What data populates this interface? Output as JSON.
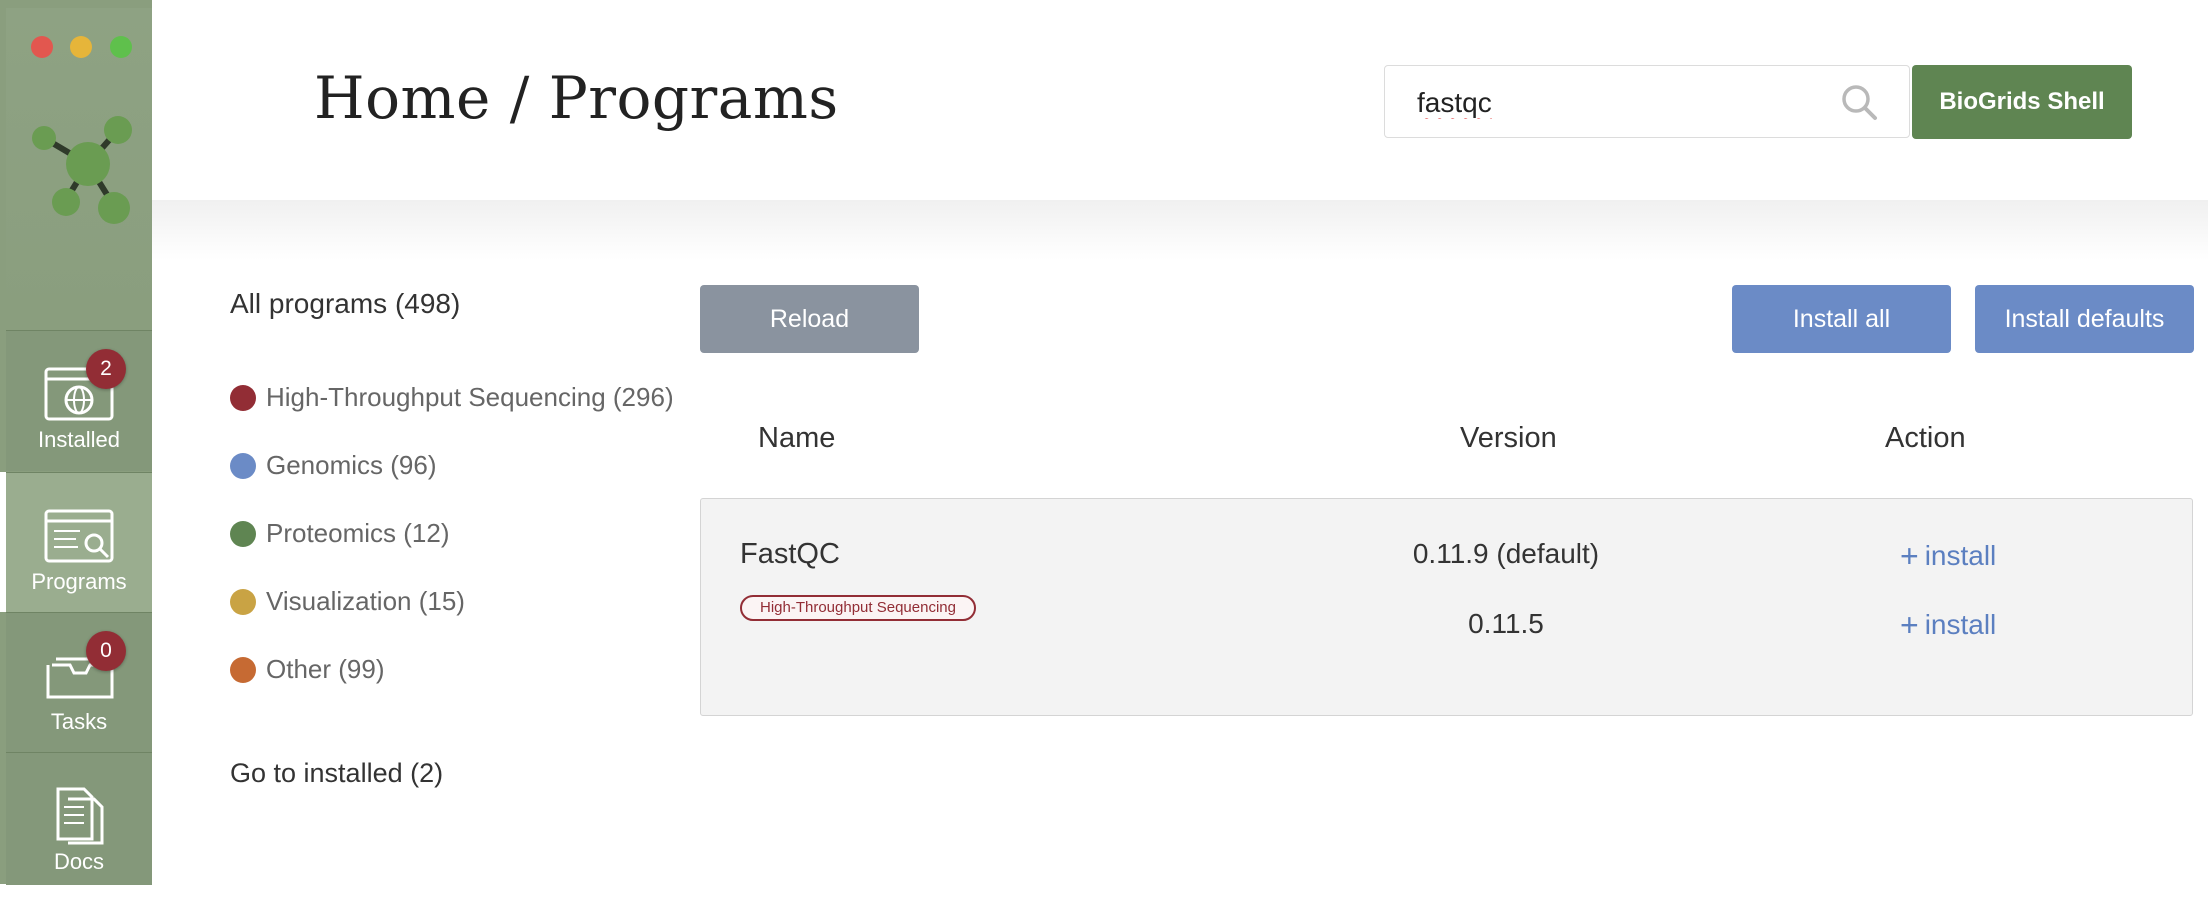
{
  "app": {
    "colors": {
      "sidebar": "#8a9e7e",
      "accent_green": "#5f8552",
      "accent_blue": "#6b8bc6",
      "badge": "#922d35"
    }
  },
  "sidebar": {
    "items": [
      {
        "label": "Installed",
        "icon": "globe-window-icon",
        "badge": "2"
      },
      {
        "label": "Programs",
        "icon": "programs-search-icon",
        "badge": null
      },
      {
        "label": "Tasks",
        "icon": "folder-tray-icon",
        "badge": "0"
      },
      {
        "label": "Docs",
        "icon": "documents-icon",
        "badge": null
      }
    ]
  },
  "header": {
    "title": "Home / Programs",
    "search_value": "fastqc",
    "shell_button": "BioGrids Shell"
  },
  "categories": {
    "all": "All programs (498)",
    "items": [
      {
        "label": "High-Throughput Sequencing (296)",
        "color": "#922d35"
      },
      {
        "label": "Genomics (96)",
        "color": "#6b8bc6"
      },
      {
        "label": "Proteomics (12)",
        "color": "#5f8552"
      },
      {
        "label": "Visualization (15)",
        "color": "#c9a344"
      },
      {
        "label": "Other (99)",
        "color": "#c66a33"
      }
    ],
    "goto_installed": "Go to installed (2)"
  },
  "toolbar": {
    "reload": "Reload",
    "install_all": "Install all",
    "install_defaults": "Install defaults"
  },
  "table": {
    "headers": {
      "name": "Name",
      "version": "Version",
      "action": "Action"
    },
    "rows": [
      {
        "name": "FastQC",
        "tag": "High-Throughput Sequencing",
        "versions": [
          {
            "version": "0.11.9 (default)",
            "action": "install"
          },
          {
            "version": "0.11.5",
            "action": "install"
          }
        ]
      }
    ]
  }
}
